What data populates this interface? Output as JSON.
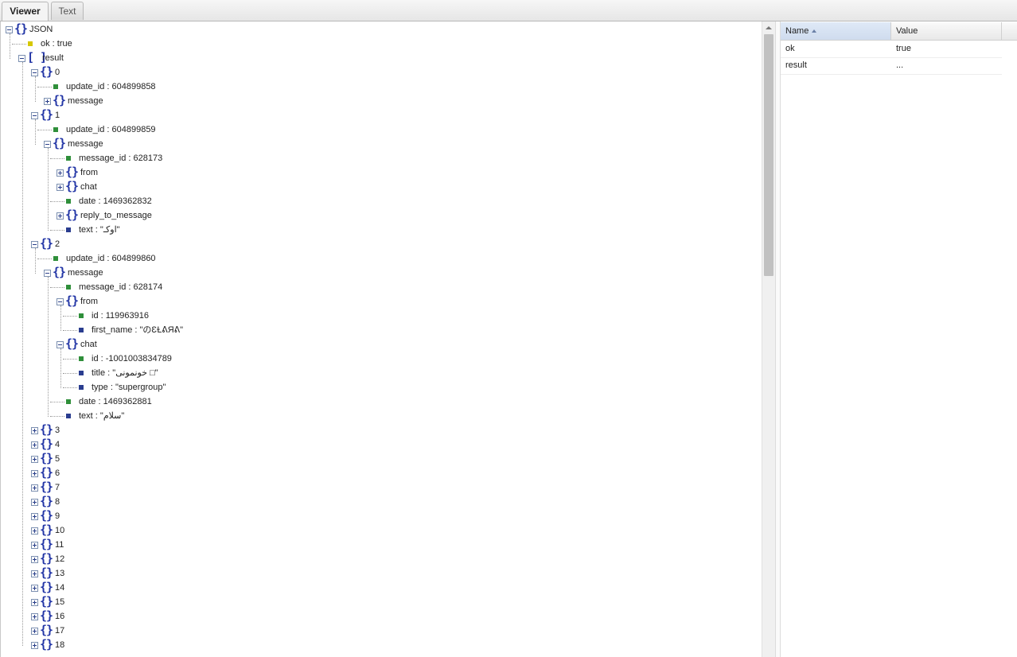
{
  "tabs": {
    "viewer": "Viewer",
    "text": "Text"
  },
  "tree": {
    "root": "JSON",
    "ok": "ok : true",
    "result": "result",
    "n0": {
      "label": "0",
      "update_id": "update_id : 604899858",
      "message": "message"
    },
    "n1": {
      "label": "1",
      "update_id": "update_id : 604899859",
      "message": "message",
      "message_id": "message_id : 628173",
      "from": "from",
      "chat": "chat",
      "date": "date : 1469362832",
      "reply_to_message": "reply_to_message",
      "text": "text : \"اوکـ\""
    },
    "n2": {
      "label": "2",
      "update_id": "update_id : 604899860",
      "message": "message",
      "message_id": "message_id : 628174",
      "from": "from",
      "from_id": "id : 119963916",
      "from_first_name": "first_name : \"のƐⱢᕕЯᕕ\"",
      "chat": "chat",
      "chat_id": "id : -1001003834789",
      "chat_title": "title : \"خونمونی □\"",
      "chat_type": "type : \"supergroup\"",
      "date": "date : 1469362881",
      "text": "text : \"سلام\""
    },
    "collapsed": [
      "3",
      "4",
      "5",
      "6",
      "7",
      "8",
      "9",
      "10",
      "11",
      "12",
      "13",
      "14",
      "15",
      "16",
      "17",
      "18"
    ]
  },
  "grid": {
    "columns": {
      "name": "Name",
      "value": "Value"
    },
    "rows": [
      {
        "name": "ok",
        "value": "true"
      },
      {
        "name": "result",
        "value": "..."
      }
    ]
  },
  "colors": {
    "brace": "#2336a6",
    "number_leaf": "#2f8f3a",
    "bool_leaf": "#d6c800",
    "string_leaf": "#2a3d8f"
  }
}
